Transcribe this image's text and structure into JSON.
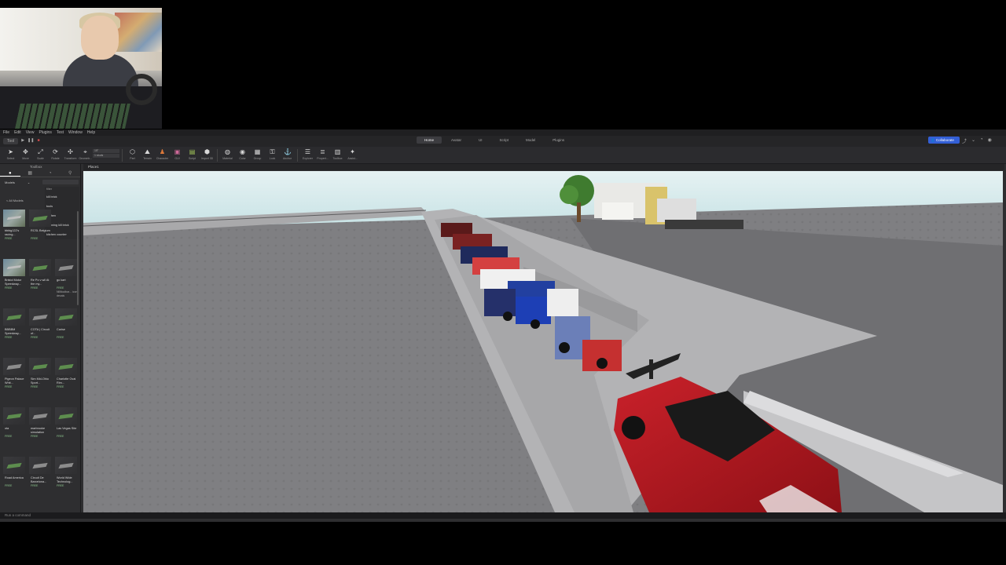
{
  "menubar": {
    "items": [
      "File",
      "Edit",
      "View",
      "Plugins",
      "Test",
      "Window",
      "Help"
    ]
  },
  "title_tabs": [
    {
      "label": "Home",
      "active": true
    },
    {
      "label": "Avatar",
      "active": false
    },
    {
      "label": "UI",
      "active": false
    },
    {
      "label": "Script",
      "active": false
    },
    {
      "label": "Model",
      "active": false
    },
    {
      "label": "Plugins",
      "active": false
    }
  ],
  "collaborate_label": "Collaborate",
  "file_mini": {
    "mode": "Tool"
  },
  "ribbon": {
    "tools": [
      {
        "label": "Select",
        "icon": "cursor-icon"
      },
      {
        "label": "Move",
        "icon": "move-icon"
      },
      {
        "label": "Scale",
        "icon": "scale-icon"
      },
      {
        "label": "Rotate",
        "icon": "rotate-icon"
      },
      {
        "label": "Transform",
        "icon": "transform-icon"
      },
      {
        "label": "Geometr...",
        "icon": "geometry-icon"
      }
    ],
    "snap": {
      "rotate": "15°",
      "move": "1 studs"
    },
    "tools2": [
      {
        "label": "Part",
        "icon": "part-icon"
      },
      {
        "label": "Terrain",
        "icon": "terrain-icon"
      },
      {
        "label": "Character",
        "icon": "character-icon"
      },
      {
        "label": "GUI",
        "icon": "gui-icon"
      },
      {
        "label": "Script",
        "icon": "script-icon"
      },
      {
        "label": "Import 3D",
        "icon": "import-icon"
      }
    ],
    "tools3": [
      {
        "label": "Material",
        "icon": "material-icon"
      },
      {
        "label": "Color",
        "icon": "color-icon"
      },
      {
        "label": "Group",
        "icon": "group-icon"
      },
      {
        "label": "Lock",
        "icon": "lock-icon"
      },
      {
        "label": "Anchor",
        "icon": "anchor-icon"
      }
    ],
    "tools4": [
      {
        "label": "Explorer",
        "icon": "explorer-icon"
      },
      {
        "label": "Propert...",
        "icon": "properties-icon"
      },
      {
        "label": "Toolbox",
        "icon": "toolbox-icon"
      },
      {
        "label": "Assist...",
        "icon": "assistant-icon"
      }
    ]
  },
  "toolbox": {
    "title": "Toolbox",
    "category": "Models",
    "back_label": "< All Models",
    "suggestions": [
      "filter",
      "kill brick",
      "tools",
      "kitchen",
      "spinning kill brick",
      "kitchen counter"
    ],
    "tiles": [
      {
        "name": "bbbig122's racing...",
        "price": "FREE",
        "thumb": "photo"
      },
      {
        "name": "RCSL Belgium",
        "price": "FREE",
        "thumb": "green"
      },
      {
        "name": "",
        "price": "",
        "thumb": "none"
      },
      {
        "name": "Bristol Motor Speedway...",
        "price": "FREE",
        "thumb": "photo"
      },
      {
        "name": "Re Po v wll At the my...",
        "price": "FREE",
        "thumb": "green"
      },
      {
        "name": "go kart",
        "price": "FREE",
        "thumb": "grey",
        "extra": "Nillitoolbar... icon decals"
      },
      {
        "name": "BBBBM Speedway...",
        "price": "FREE",
        "thumb": "green"
      },
      {
        "name": "COTA | Circuit of...",
        "price": "FREE",
        "thumb": "grey"
      },
      {
        "name": "Carise",
        "price": "FREE",
        "thumb": "green"
      },
      {
        "name": "Pigeon Palace Whit...",
        "price": "FREE",
        "thumb": "grey"
      },
      {
        "name": "Sim Mid-Ohio Sport...",
        "price": "FREE",
        "thumb": "green"
      },
      {
        "name": "Charlotte Oval Rim...",
        "price": "FREE",
        "thumb": "green"
      },
      {
        "name": "ota",
        "price": "FREE",
        "thumb": "green"
      },
      {
        "name": "marbrooke simulation",
        "price": "FREE",
        "thumb": "grey"
      },
      {
        "name": "Las Vegas Site",
        "price": "FREE",
        "thumb": "green"
      },
      {
        "name": "Road America",
        "price": "FREE",
        "thumb": "green"
      },
      {
        "name": "Circuit De Barcelona...",
        "price": "FREE",
        "thumb": "grey"
      },
      {
        "name": "World Wide Technolog...",
        "price": "FREE",
        "thumb": "grey"
      }
    ]
  },
  "viewport": {
    "tab_label": "Place1"
  },
  "command_bar": {
    "placeholder": "Run a command"
  },
  "colors": {
    "accent": "#335fd6",
    "panel": "#2e2e30",
    "sky": "#bddde0",
    "baseplate": "#7d7d80"
  }
}
